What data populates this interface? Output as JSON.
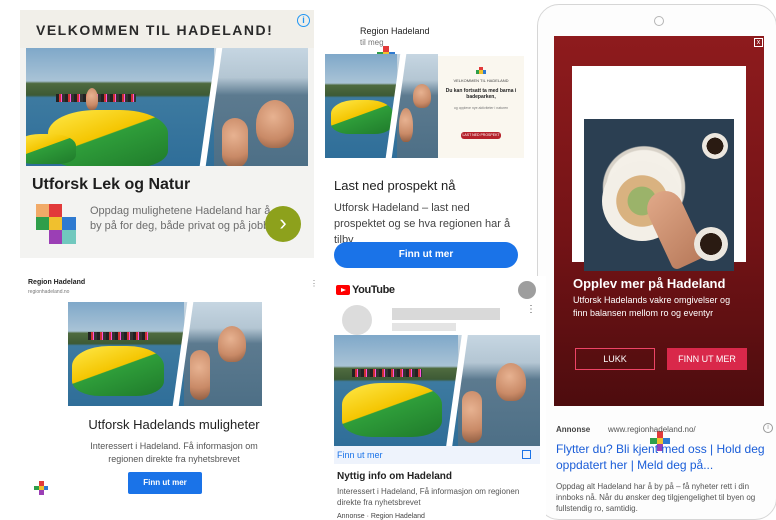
{
  "panel1": {
    "banner": "VELKOMMEN TIL HADELAND!",
    "title": "Utforsk Lek og Natur",
    "description": "Oppdag mulighetene Hadeland har å by på for deg, både privat og på jobb.",
    "info_icon": "info-icon",
    "arrow_icon": "chevron-right-icon",
    "arrow_symbol": "›",
    "accent": "#8da11c"
  },
  "panel2": {
    "org": "Region Hadeland",
    "time": "til meg",
    "heading": "Last ned prospekt nå",
    "description": "Utforsk Hadeland – last ned prospektet og se hva regionen har å tilby",
    "button": "Finn ut mer",
    "inner": {
      "label": "VELKOMMEN TIL HADELAND",
      "headline": "Du kan fortsatt ta med barna i badeparken,",
      "body": "og oppleve nye aktiviteter i naturen",
      "button": "LAST NED PROSPEKT"
    }
  },
  "panel3": {
    "title": "Opplev mer på Hadeland",
    "subtitle": "Utforsk Hadelands vakre omgivelser og finn balansen mellom ro og eventyr",
    "close_symbol": "x",
    "btn_close": "LUKK",
    "btn_more": "FINN UT MER",
    "ann_label": "Annonse",
    "ann_url": "www.regionhadeland.no/",
    "ann_info": "i",
    "link": "Flytter du? Bli kjent med oss | Hold deg oppdatert her | Meld deg på...",
    "body": "Oppdag alt Hadeland har å by på – få nyheter rett i din innboks nå. Når du ønsker deg tilgjengelighet til byen og fullstendig ro, samtidig.",
    "brand_color": "#d9284a"
  },
  "panel4": {
    "org": "Region Hadeland",
    "url": "regionhadeland.no",
    "dots": "⋮",
    "title": "Utforsk Hadelands muligheter",
    "description": "Interessert i Hadeland. Få informasjon om regionen direkte fra nyhetsbrevet",
    "button": "Finn ut mer"
  },
  "panel5": {
    "platform": "YouTube",
    "dots": "⋮",
    "strip_cta": "Finn ut mer",
    "title": "Nyttig info om Hadeland",
    "description": "Interessert i Hadeland, Få informasjon om regionen direkte fra nyhetsbrevet",
    "ann": "Annonse · Region Hadeland",
    "ext_icon": "external-link-icon"
  }
}
